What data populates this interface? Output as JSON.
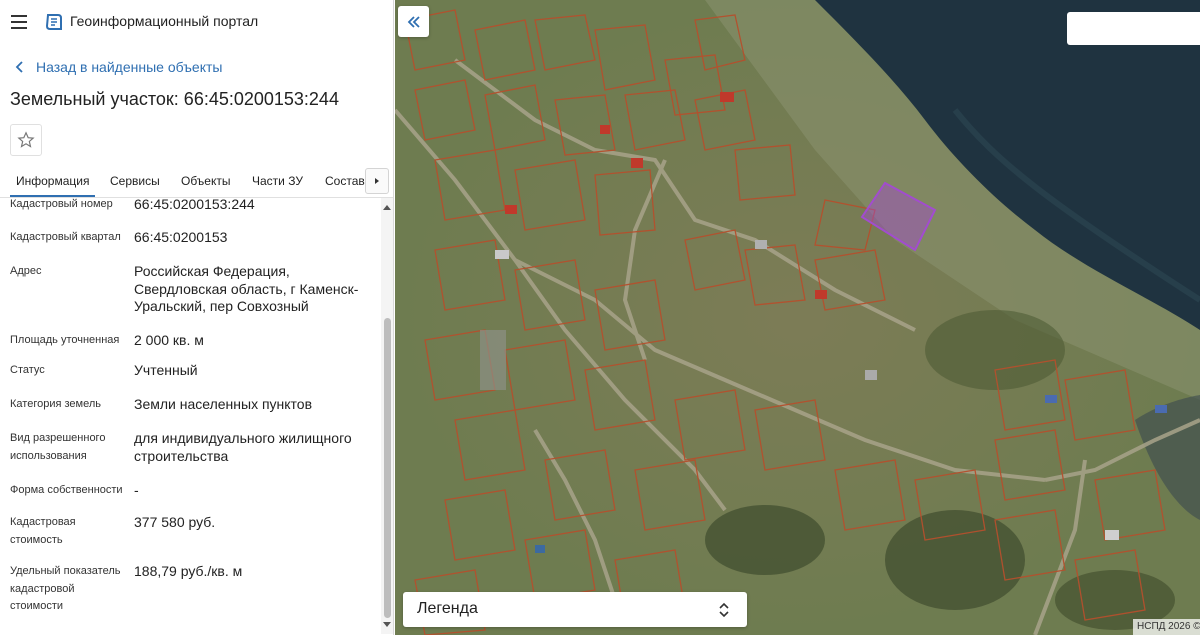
{
  "header": {
    "app_title": "Геоинформационный портал",
    "menu_icon": "hamburger-menu-icon",
    "logo_icon": "portal-logo-icon"
  },
  "back_link": {
    "label": "Назад в найденные объекты"
  },
  "object": {
    "title": "Земельный участок: 66:45:0200153:244"
  },
  "tabs": [
    {
      "label": "Информация",
      "active": true
    },
    {
      "label": "Сервисы"
    },
    {
      "label": "Объекты"
    },
    {
      "label": "Части ЗУ"
    },
    {
      "label": "Состав"
    }
  ],
  "info": [
    {
      "label": "Кадастровый номер",
      "value": "66:45:0200153:244"
    },
    {
      "label": "Кадастровый квартал",
      "value": "66:45:0200153"
    },
    {
      "label": "Адрес",
      "value": "Российская Федерация, Свердловская область, г Каменск-Уральский, пер Совхозный"
    },
    {
      "label": "Площадь уточненная",
      "value": "2 000 кв. м"
    },
    {
      "label": "Статус",
      "value": "Учтенный"
    },
    {
      "label": "Категория земель",
      "value": "Земли населенных пунктов"
    },
    {
      "label": "Вид разрешенного использования",
      "value": "для индивидуального жилищного строительства"
    },
    {
      "label": "Форма собственности",
      "value": "-"
    },
    {
      "label": "Кадастровая стоимость",
      "value": "377 580 руб."
    },
    {
      "label": "Удельный показатель кадастровой стоимости",
      "value": "188,79 руб./кв. м"
    }
  ],
  "map": {
    "search": {
      "value": "",
      "placeholder": ""
    },
    "legend_label": "Легенда",
    "attribution": "НСПД 2026 ©",
    "colors": {
      "water": "#1f3340",
      "parcel_border": "#b5502d",
      "selected_parcel": "#a24ccf",
      "link": "#2f6fb1"
    }
  }
}
